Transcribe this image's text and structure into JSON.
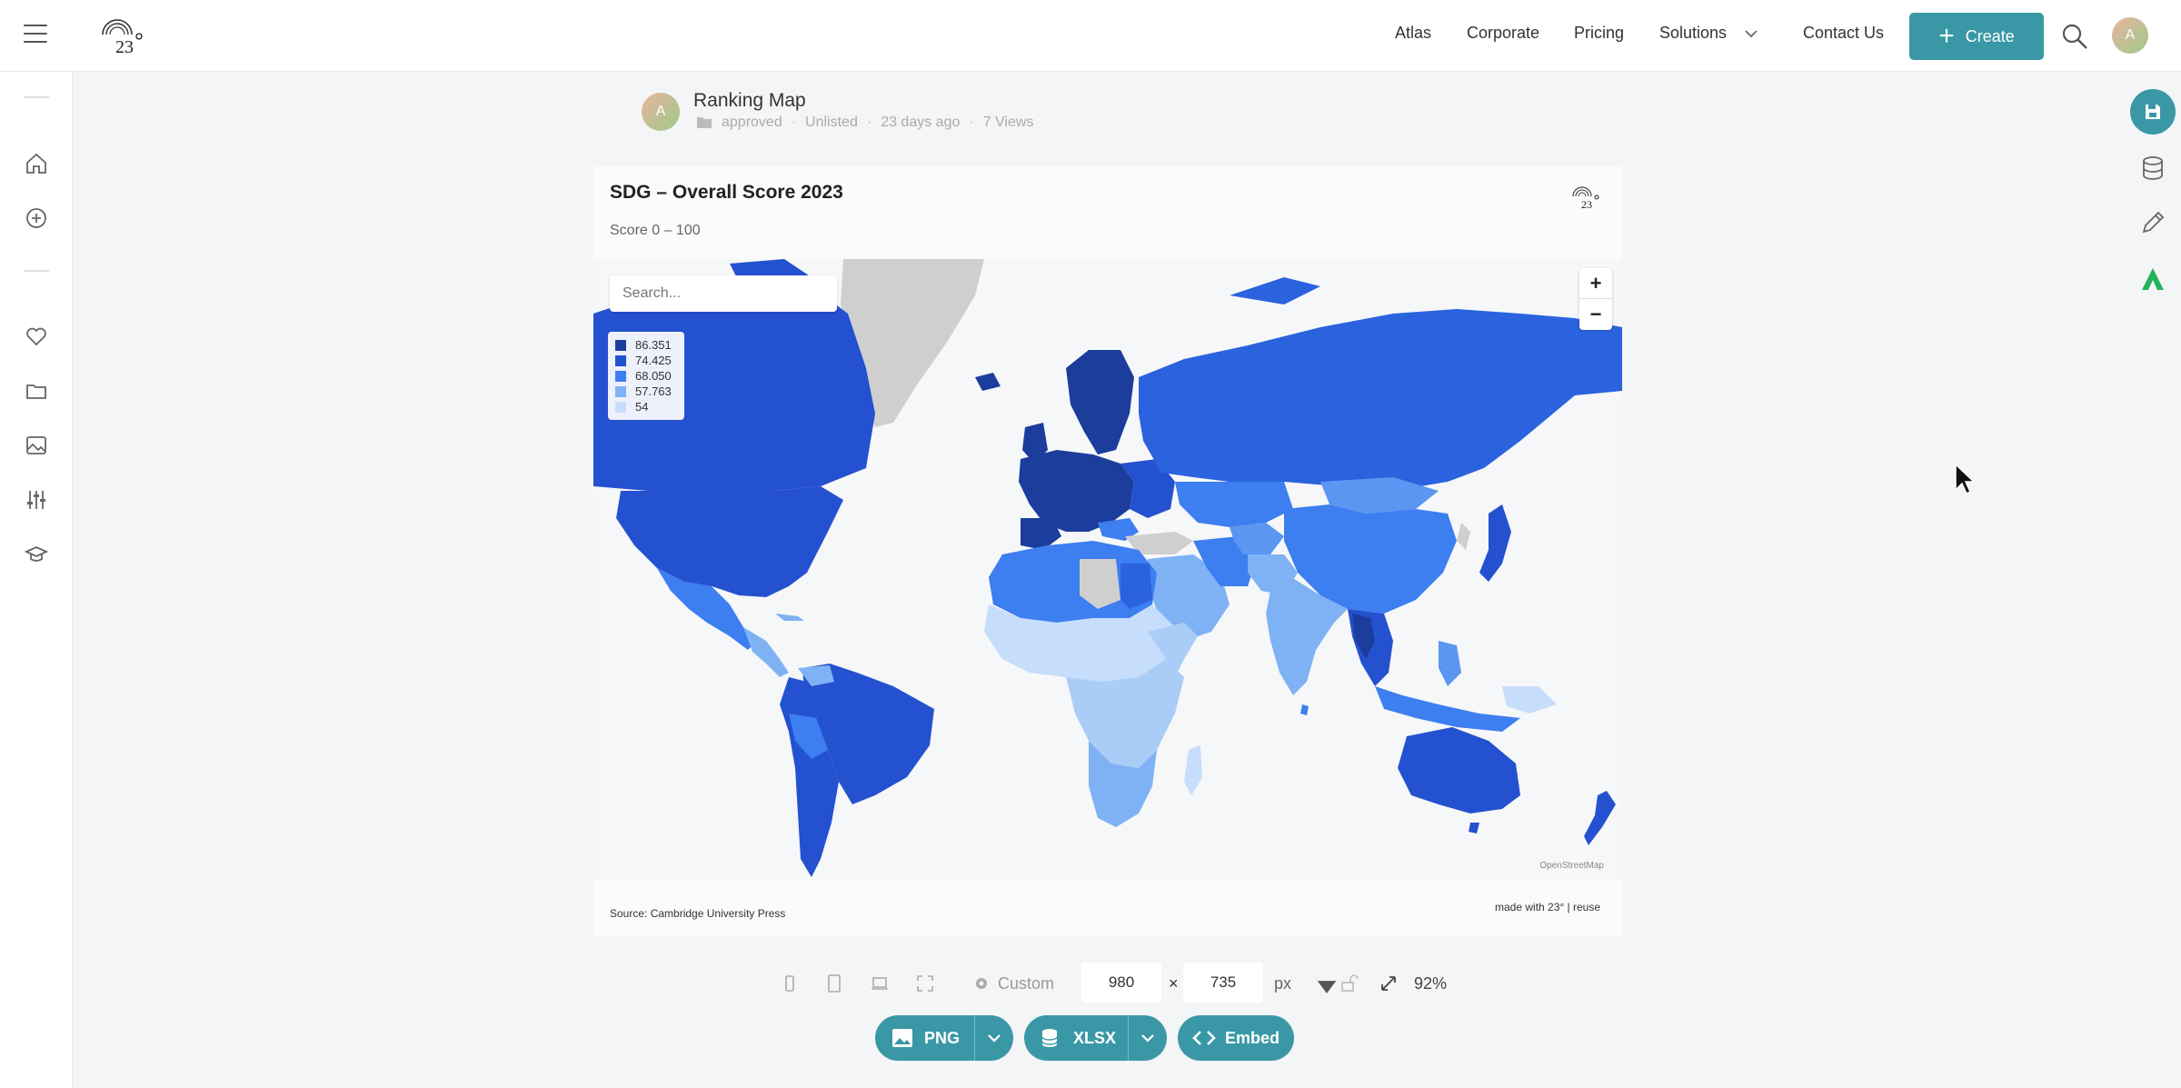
{
  "nav": {
    "items": [
      "Atlas",
      "Corporate",
      "Pricing",
      "Solutions",
      "Contact Us"
    ],
    "create_label": "Create",
    "user_initial": "A"
  },
  "header": {
    "owner_initial": "A",
    "title": "Ranking Map",
    "folder": "approved",
    "visibility": "Unlisted",
    "updated": "23 days ago",
    "views": "7 Views"
  },
  "map": {
    "title": "SDG – Overall Score 2023",
    "subtitle": "Score 0 – 100",
    "search_placeholder": "Search...",
    "legend": [
      {
        "label": "86.351",
        "color": "#1c3d9c"
      },
      {
        "label": "74.425",
        "color": "#2451cf"
      },
      {
        "label": "68.050",
        "color": "#3d7ef0"
      },
      {
        "label": "57.763",
        "color": "#7fb2f5"
      },
      {
        "label": "54",
        "color": "#c6ddfb"
      }
    ],
    "zoom_in": "+",
    "zoom_out": "−",
    "attribution": "OpenStreetMap",
    "source_prefix": "Source:",
    "source": "Cambridge University Press",
    "made_with": "made with 23° | reuse"
  },
  "toolbar": {
    "preset": "Custom",
    "width": "980",
    "times": "×",
    "height": "735",
    "unit": "px",
    "zoom": "92%"
  },
  "export": {
    "png": "PNG",
    "xlsx": "XLSX",
    "embed": "Embed"
  },
  "colors": {
    "accent": "#3a98a6",
    "no_data": "#cfcfcf"
  }
}
